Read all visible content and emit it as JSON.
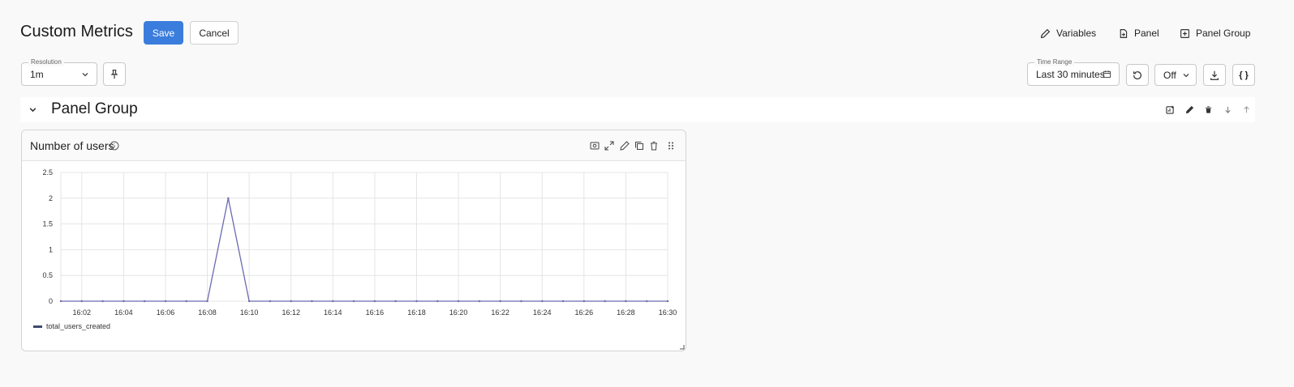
{
  "header": {
    "title": "Custom Metrics",
    "save_label": "Save",
    "cancel_label": "Cancel",
    "variables_label": "Variables",
    "panel_label": "Panel",
    "panel_group_label": "Panel Group"
  },
  "toolbar": {
    "resolution_label": "Resolution",
    "resolution_value": "1m",
    "time_range_label": "Time Range",
    "time_range_value": "Last 30 minutes",
    "refresh_value": "Off",
    "json_label": "{ }"
  },
  "group": {
    "title": "Panel Group"
  },
  "panel": {
    "title": "Number of users"
  },
  "chart_data": {
    "type": "line",
    "x": [
      "16:01",
      "16:02",
      "16:03",
      "16:04",
      "16:05",
      "16:06",
      "16:07",
      "16:08",
      "16:09",
      "16:10",
      "16:11",
      "16:12",
      "16:13",
      "16:14",
      "16:15",
      "16:16",
      "16:17",
      "16:18",
      "16:19",
      "16:20",
      "16:21",
      "16:22",
      "16:23",
      "16:24",
      "16:25",
      "16:26",
      "16:27",
      "16:28",
      "16:29",
      "16:30"
    ],
    "tick_labels": [
      "16:02",
      "16:04",
      "16:06",
      "16:08",
      "16:10",
      "16:12",
      "16:14",
      "16:16",
      "16:18",
      "16:20",
      "16:22",
      "16:24",
      "16:26",
      "16:28",
      "16:30"
    ],
    "y_ticks": [
      "2.5",
      "2",
      "1.5",
      "1",
      "0.5",
      "0"
    ],
    "series": [
      {
        "name": "total_users_created",
        "color": "#6a6ab0",
        "values": [
          0,
          0,
          0,
          0,
          0,
          0,
          0,
          0,
          2,
          0,
          0,
          0,
          0,
          0,
          0,
          0,
          0,
          0,
          0,
          0,
          0,
          0,
          0,
          0,
          0,
          0,
          0,
          0,
          0,
          0
        ]
      }
    ],
    "ylim": [
      0,
      2.5
    ],
    "grid": true,
    "legend": "bottom-left"
  }
}
